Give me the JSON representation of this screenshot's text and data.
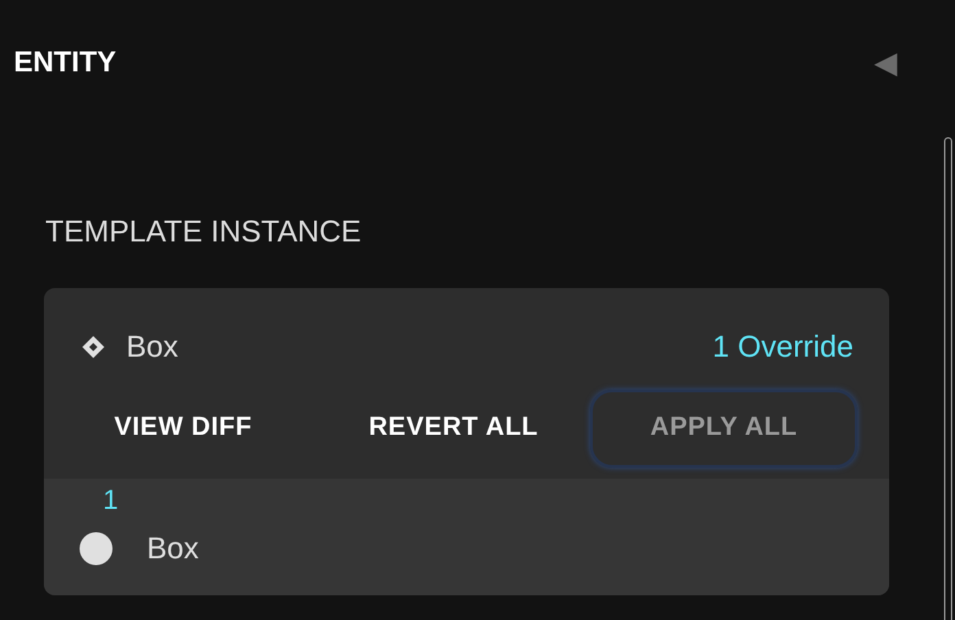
{
  "panel": {
    "title": "ENTITY",
    "collapse_icon": "◀"
  },
  "section": {
    "title": "TEMPLATE INSTANCE"
  },
  "template": {
    "name": "Box",
    "overrides": "1 Override"
  },
  "buttons": [
    {
      "label": "VIEW DIFF",
      "disabled": false,
      "focused": false
    },
    {
      "label": "REVERT ALL",
      "disabled": false,
      "focused": false
    },
    {
      "label": "APPLY ALL",
      "disabled": true,
      "focused": true
    }
  ],
  "items": [
    {
      "badge": "1",
      "name": "Box"
    }
  ]
}
